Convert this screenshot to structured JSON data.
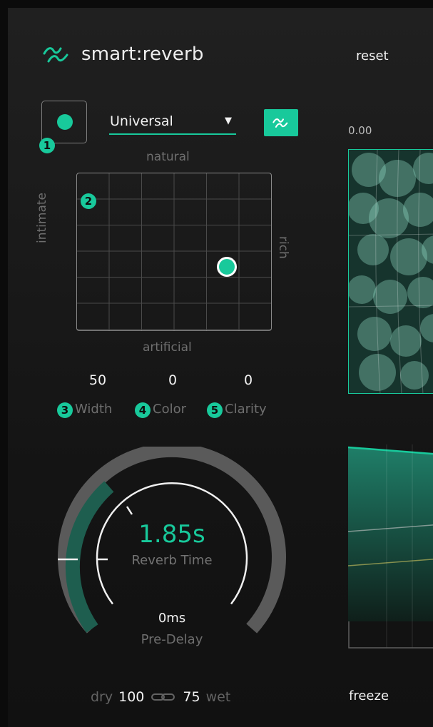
{
  "app": {
    "brand": "smart:reverb",
    "reset_label": "reset"
  },
  "preset": {
    "selected": "Universal"
  },
  "top_readout": "0.00",
  "badges": [
    "1",
    "2",
    "3",
    "4",
    "5"
  ],
  "xy_pad": {
    "top_label": "natural",
    "bottom_label": "artificial",
    "left_label": "intimate",
    "right_label": "rich"
  },
  "params": [
    {
      "label": "Width",
      "value": "50"
    },
    {
      "label": "Color",
      "value": "0"
    },
    {
      "label": "Clarity",
      "value": "0"
    }
  ],
  "reverb": {
    "time_value": "1.85s",
    "time_label": "Reverb Time",
    "predelay_value": "0ms",
    "predelay_label": "Pre-Delay"
  },
  "mix": {
    "dry_label": "dry",
    "dry_value": "100",
    "wet_value": "75",
    "wet_label": "wet"
  },
  "freeze_label": "freeze",
  "colors": {
    "accent": "#18c99b",
    "background": "#1a1a1a",
    "muted": "#6e6e6e"
  },
  "icons": {
    "logo": "smart-waves-icon",
    "smart_button": "smart-waves-icon",
    "link": "chain-link-icon",
    "dropdown": "caret-down-icon"
  }
}
